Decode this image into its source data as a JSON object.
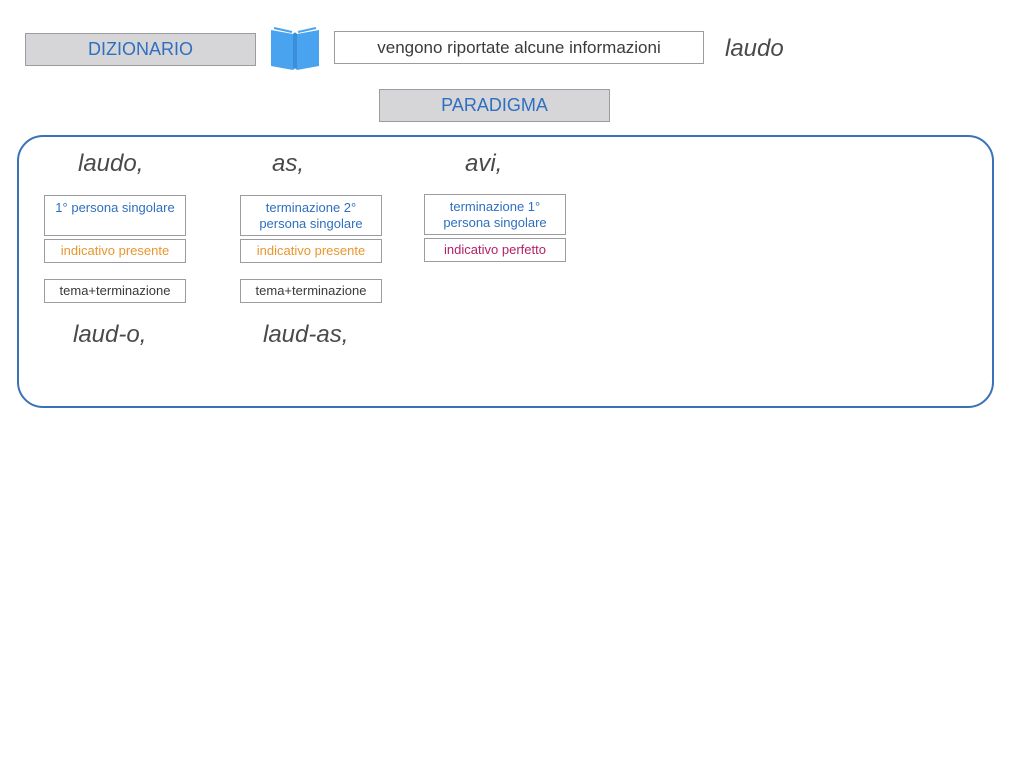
{
  "header": {
    "dizionario_label": "DIZIONARIO",
    "info_text": "vengono riportate alcune informazioni",
    "entry_word": "laudo",
    "book_icon": "open-book-icon",
    "paradigma_label": "PARADIGMA"
  },
  "paradigma": {
    "forms": [
      "laudo,",
      "as,",
      "avi,"
    ],
    "col1": {
      "grammar": "1° persona singolare",
      "mood": "indicativo presente",
      "structure": "tema+terminazione",
      "split": "laud-o,"
    },
    "col2": {
      "grammar": "terminazione 2° persona singolare",
      "mood": "indicativo presente",
      "structure": "tema+terminazione",
      "split": "laud-as,"
    },
    "col3": {
      "grammar": "terminazione 1° persona singolare",
      "mood": "indicativo perfetto"
    }
  },
  "colors": {
    "blue": "#2f6fbf",
    "orange": "#e8962e",
    "magenta": "#b3206a",
    "border_blue": "#3a72b8"
  }
}
